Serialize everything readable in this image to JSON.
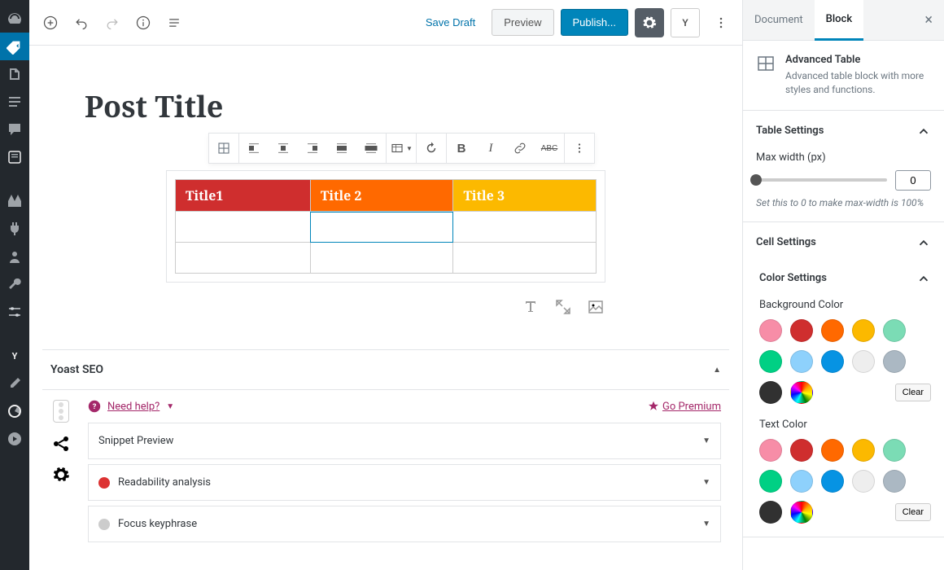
{
  "topbar": {
    "save_draft": "Save Draft",
    "preview": "Preview",
    "publish": "Publish..."
  },
  "post": {
    "title": "Post Title"
  },
  "table": {
    "headers": [
      "Title1",
      "Title 2",
      "Title 3"
    ]
  },
  "sidebar": {
    "tabs": {
      "document": "Document",
      "block": "Block"
    },
    "block_info": {
      "title": "Advanced Table",
      "desc": "Advanced table block with more styles and functions."
    },
    "table_settings": {
      "heading": "Table Settings",
      "max_width_label": "Max width (px)",
      "max_width_value": "0",
      "hint": "Set this to 0 to make max-width is 100%"
    },
    "cell_settings": {
      "heading": "Cell Settings"
    },
    "color_settings": {
      "heading": "Color Settings",
      "bg_label": "Background Color",
      "text_label": "Text Color",
      "clear": "Clear"
    },
    "palette": [
      "#f78da7",
      "#cf2e2e",
      "#ff6900",
      "#fcb900",
      "#7bdcb5",
      "#00d084",
      "#8ed1fc",
      "#0693e3",
      "#eeeeee",
      "#abb8c3",
      "#313131"
    ]
  },
  "yoast": {
    "title": "Yoast SEO",
    "help": "Need help?",
    "premium": "Go Premium",
    "items": {
      "snippet": "Snippet Preview",
      "readability": "Readability analysis",
      "focus": "Focus keyphrase"
    }
  }
}
